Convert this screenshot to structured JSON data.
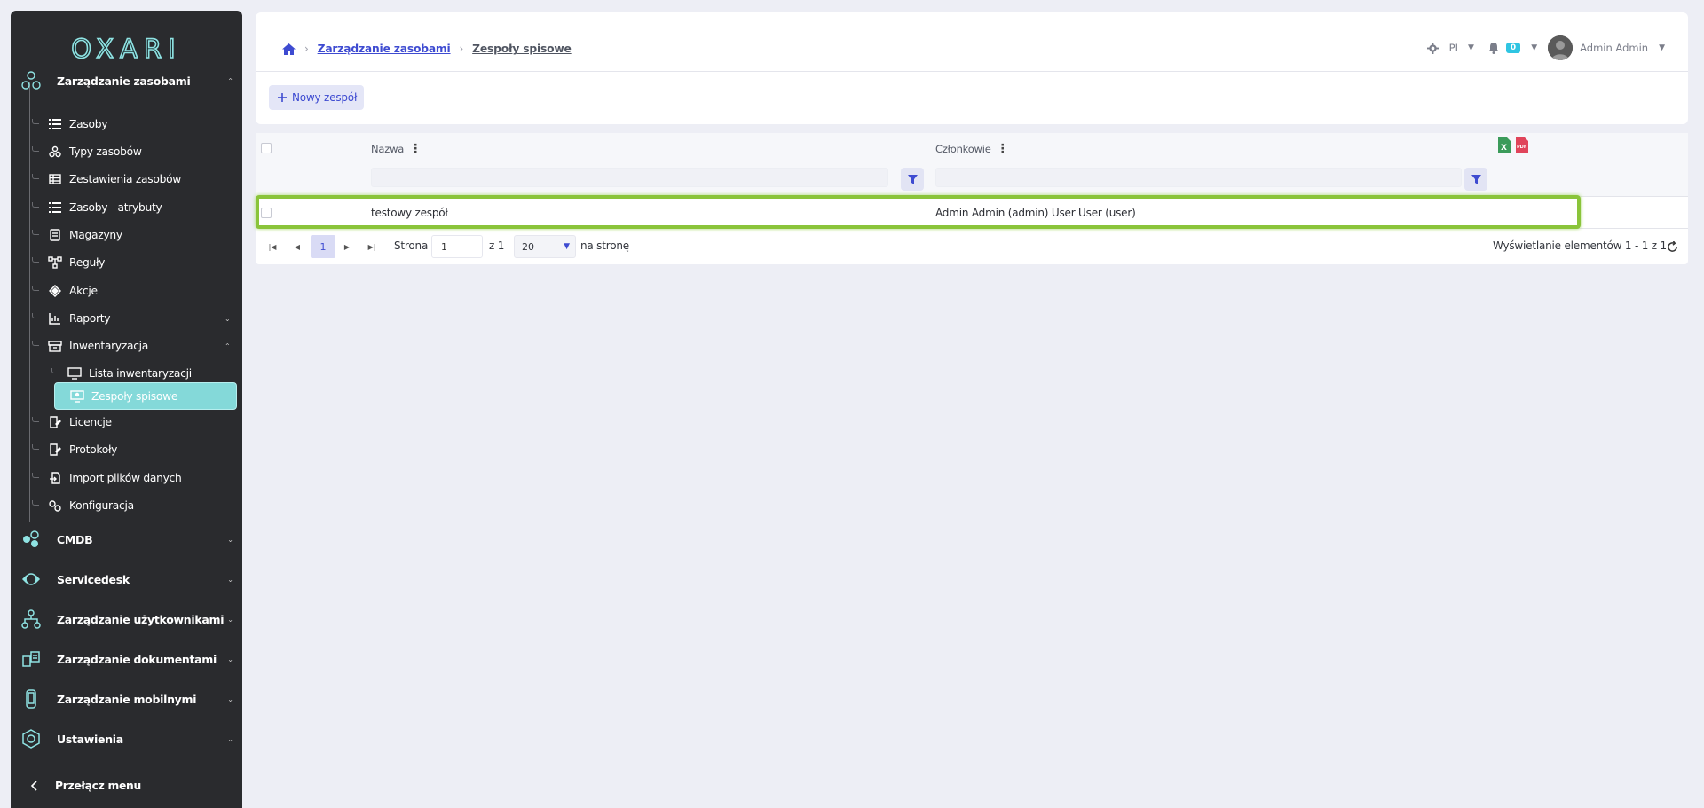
{
  "sidebar": {
    "logo": "OXARI",
    "sections": {
      "assets": "Zarządzanie zasobami",
      "cmdb": "CMDB",
      "servicedesk": "Servicedesk",
      "users": "Zarządzanie użytkownikami",
      "documents": "Zarządzanie dokumentami",
      "mobile": "Zarządzanie mobilnymi",
      "settings": "Ustawienia"
    },
    "items": {
      "zasoby": "Zasoby",
      "typy": "Typy zasobów",
      "zestawienia": "Zestawienia zasobów",
      "atrybuty": "Zasoby - atrybuty",
      "magazyny": "Magazyny",
      "reguly": "Reguły",
      "akcje": "Akcje",
      "raporty": "Raporty",
      "inwentaryzacja": "Inwentaryzacja",
      "lista": "Lista inwentaryzacji",
      "zespoly": "Zespoły spisowe",
      "licencje": "Licencje",
      "protokoly": "Protokoły",
      "import": "Import plików danych",
      "konfiguracja": "Konfiguracja"
    },
    "toggle_label": "Przełącz menu"
  },
  "header": {
    "breadcrumb": {
      "parent": "Zarządzanie zasobami",
      "current": "Zespoły spisowe"
    },
    "language": "PL",
    "notifications_count": "0",
    "user_name": "Admin Admin"
  },
  "toolbar": {
    "new_team_label": "Nowy zespół"
  },
  "grid": {
    "columns": {
      "name": "Nazwa",
      "members": "Członkowie"
    },
    "rows": [
      {
        "name": "testowy zespół",
        "members": "Admin Admin (admin) User User (user)"
      }
    ],
    "pager": {
      "current_page": "1",
      "page_label": "Strona",
      "page_input": "1",
      "of_label": "z 1",
      "page_size": "20",
      "per_page_label": "na stronę",
      "summary": "Wyświetlanie elementów 1 - 1 z 1"
    }
  },
  "colors": {
    "sidebar_bg": "#2a2b2e",
    "active_item": "#84d9d9",
    "accent": "#3e4bd1",
    "highlight": "#8ac43a",
    "badge": "#2fc5e2"
  }
}
